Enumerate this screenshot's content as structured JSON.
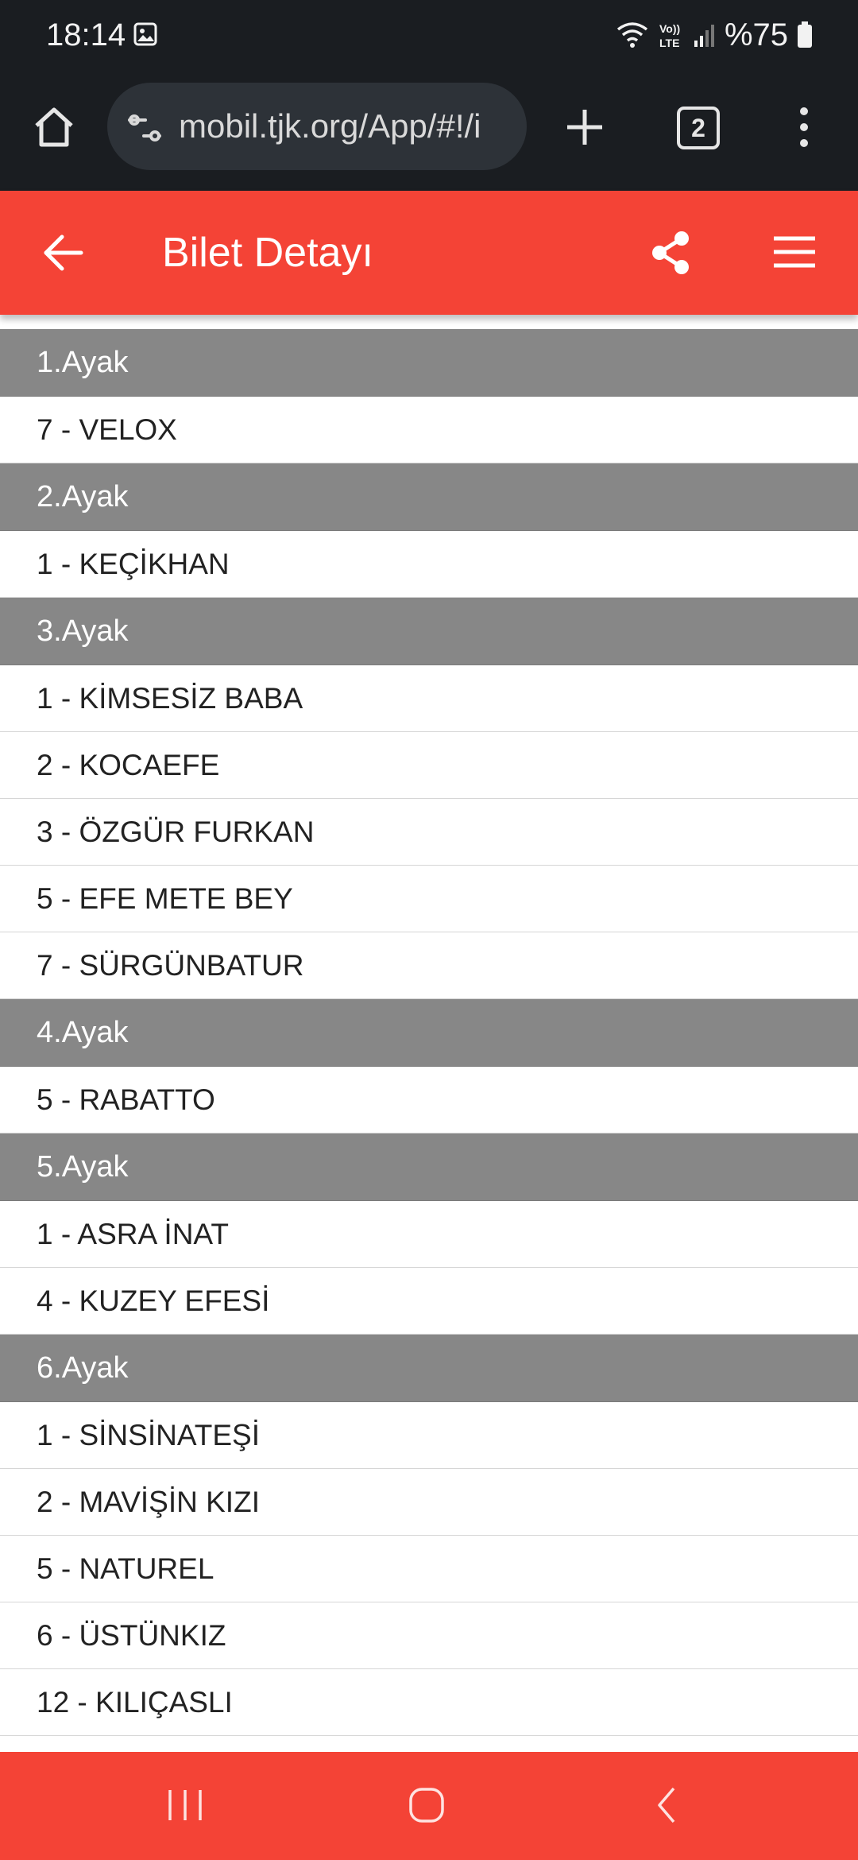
{
  "status_bar": {
    "time": "18:14",
    "battery": "%75",
    "icons": [
      "gallery-icon",
      "wifi-icon",
      "volte-icon",
      "signal-icon",
      "battery-icon"
    ]
  },
  "browser": {
    "url": "mobil.tjk.org/App/#!/i",
    "tab_count": "2",
    "icons": [
      "home-icon",
      "site-settings-icon",
      "plus-icon",
      "more-vert-icon"
    ]
  },
  "header": {
    "title": "Bilet Detayı",
    "icons": [
      "arrow-back-icon",
      "share-icon",
      "menu-icon"
    ]
  },
  "legs": [
    {
      "label": "1.Ayak",
      "runners": [
        "7 - VELOX"
      ]
    },
    {
      "label": "2.Ayak",
      "runners": [
        "1 - KEÇİKHAN"
      ]
    },
    {
      "label": "3.Ayak",
      "runners": [
        "1 - KİMSESİZ BABA",
        "2 - KOCAEFE",
        "3 - ÖZGÜR FURKAN",
        "5 - EFE METE BEY",
        "7 - SÜRGÜNBATUR"
      ]
    },
    {
      "label": "4.Ayak",
      "runners": [
        "5 - RABATTO"
      ]
    },
    {
      "label": "5.Ayak",
      "runners": [
        "1 - ASRA İNAT",
        "4 - KUZEY EFESİ"
      ]
    },
    {
      "label": "6.Ayak",
      "runners": [
        "1 - SİNSİNATEŞİ",
        "2 - MAVİŞİN KIZI",
        "5 - NATUREL",
        "6 - ÜSTÜNKIZ",
        "12 - KILIÇASLI"
      ]
    }
  ],
  "nav_bar": {
    "icons": [
      "recents-icon",
      "home-circle-icon",
      "back-chevron-icon"
    ]
  },
  "colors": {
    "accent": "#f44336",
    "leg_header_bg": "#878787",
    "browser_bg": "#1a1d21"
  }
}
